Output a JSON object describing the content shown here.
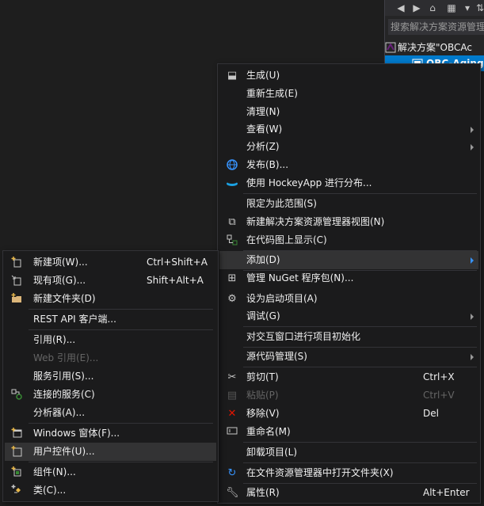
{
  "solution_explorer": {
    "search_placeholder": "搜索解决方案资源管理",
    "solution_label": "解决方案\"OBCAc",
    "project_label": "OBC-Aging"
  },
  "main_menu": {
    "items": [
      {
        "label": "生成(U)",
        "icon": "build-icon"
      },
      {
        "label": "重新生成(E)"
      },
      {
        "label": "清理(N)"
      },
      {
        "label": "查看(W)",
        "submenu": true
      },
      {
        "label": "分析(Z)",
        "submenu": true
      },
      {
        "label": "发布(B)...",
        "icon": "globe-icon"
      },
      {
        "label": "使用 HockeyApp 进行分布...",
        "icon": "hockeyapp-icon"
      },
      {
        "label": "限定为此范围(S)"
      },
      {
        "label": "新建解决方案资源管理器视图(N)",
        "icon": "new-view-icon"
      },
      {
        "label": "在代码图上显示(C)",
        "icon": "code-map-icon"
      },
      {
        "label": "添加(D)",
        "submenu": true,
        "highlighted": true
      },
      {
        "label": "管理 NuGet 程序包(N)...",
        "icon": "nuget-icon"
      },
      {
        "label": "设为启动项目(A)",
        "icon": "gear-icon"
      },
      {
        "label": "调试(G)",
        "submenu": true
      },
      {
        "label": "对交互窗口进行项目初始化"
      },
      {
        "label": "源代码管理(S)",
        "submenu": true
      },
      {
        "label": "剪切(T)",
        "shortcut": "Ctrl+X",
        "icon": "scissors-icon"
      },
      {
        "label": "粘贴(P)",
        "shortcut": "Ctrl+V",
        "icon": "paste-icon",
        "disabled": true
      },
      {
        "label": "移除(V)",
        "shortcut": "Del",
        "icon": "remove-icon"
      },
      {
        "label": "重命名(M)",
        "icon": "rename-icon"
      },
      {
        "label": "卸载项目(L)"
      },
      {
        "label": "在文件资源管理器中打开文件夹(X)",
        "icon": "open-folder-icon"
      },
      {
        "label": "属性(R)",
        "shortcut": "Alt+Enter",
        "icon": "wrench-icon"
      }
    ]
  },
  "add_submenu": {
    "items": [
      {
        "label": "新建项(W)...",
        "shortcut": "Ctrl+Shift+A",
        "icon": "new-item-icon"
      },
      {
        "label": "现有项(G)...",
        "shortcut": "Shift+Alt+A",
        "icon": "existing-item-icon"
      },
      {
        "label": "新建文件夹(D)",
        "icon": "new-folder-icon"
      },
      {
        "label": "REST API 客户端..."
      },
      {
        "label": "引用(R)..."
      },
      {
        "label": "Web 引用(E)...",
        "disabled": true
      },
      {
        "label": "服务引用(S)..."
      },
      {
        "label": "连接的服务(C)",
        "icon": "connected-service-icon"
      },
      {
        "label": "分析器(A)..."
      },
      {
        "label": "Windows 窗体(F)...",
        "icon": "windows-form-icon"
      },
      {
        "label": "用户控件(U)...",
        "icon": "user-control-icon",
        "highlighted": true
      },
      {
        "label": "组件(N)...",
        "icon": "component-icon"
      },
      {
        "label": "类(C)...",
        "icon": "class-icon"
      }
    ]
  },
  "colors": {
    "background": "#1e1e1e",
    "menu_background": "#1b1b1c",
    "highlight": "#333334",
    "accent": "#007acc",
    "disabled_text": "#656565"
  }
}
